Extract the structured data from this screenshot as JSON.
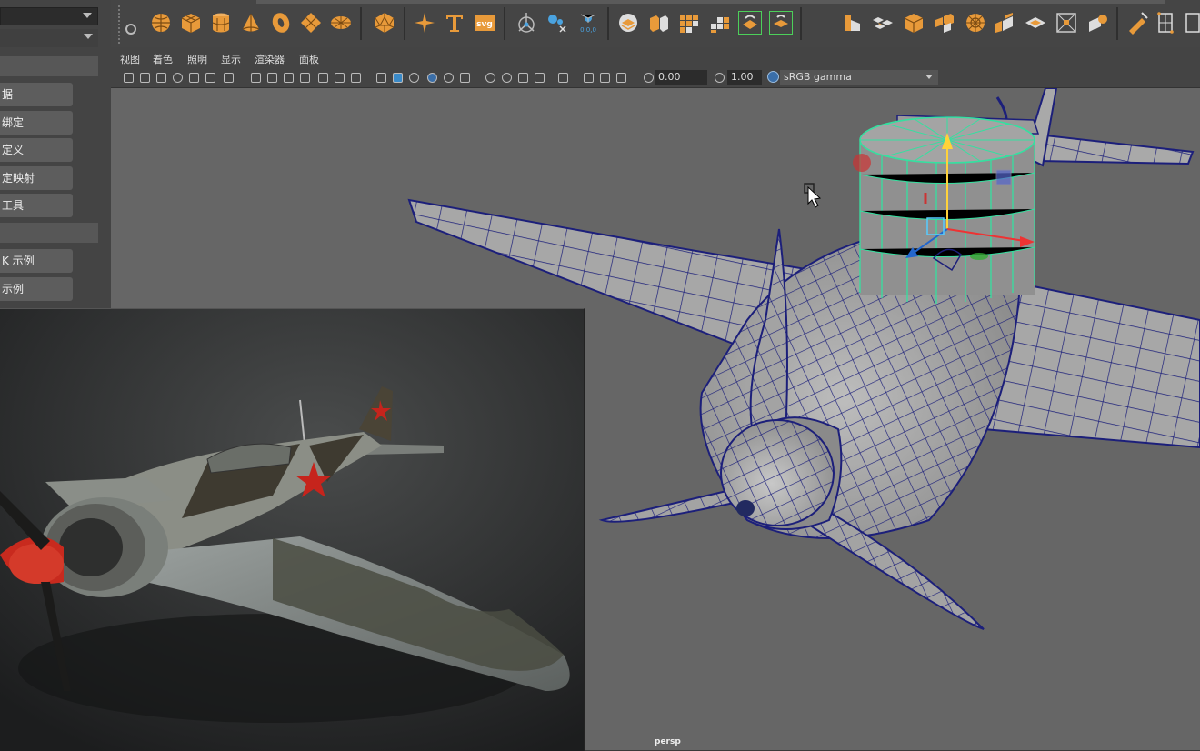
{
  "left_panel": {
    "buttons": [
      "据",
      "绑定",
      "定义",
      "定映射",
      "工具",
      "K 示例",
      "示例"
    ]
  },
  "viewport": {
    "menu": [
      "视图",
      "着色",
      "照明",
      "显示",
      "渲染器",
      "面板"
    ],
    "toolbar": {
      "exposure_value": "0.00",
      "gamma_value": "1.00",
      "color_space": "sRGB gamma"
    },
    "camera_label": "persp"
  },
  "icons": {
    "shelf": [
      "sphere-icon",
      "cube-icon",
      "cylinder-icon",
      "cone-icon",
      "torus-icon",
      "plane-icon",
      "disc-icon",
      "platonic-icon",
      "sweep-icon",
      "type-icon",
      "svg-icon",
      "pivot-icon",
      "measure-icon",
      "cluster-icon",
      "combine-icon",
      "separate-icon",
      "bevel-icon",
      "extrude-icon",
      "bridge-icon",
      "smooth-icon",
      "mirror-icon",
      "boolean-icon",
      "insert-loop-icon",
      "multicut-icon",
      "target-weld-icon",
      "quad-draw-icon",
      "uv-icon"
    ]
  },
  "colors": {
    "accent_orange": "#e89a3a",
    "wire_blue": "#1c1f7a",
    "selection_green": "#35e0a0"
  }
}
